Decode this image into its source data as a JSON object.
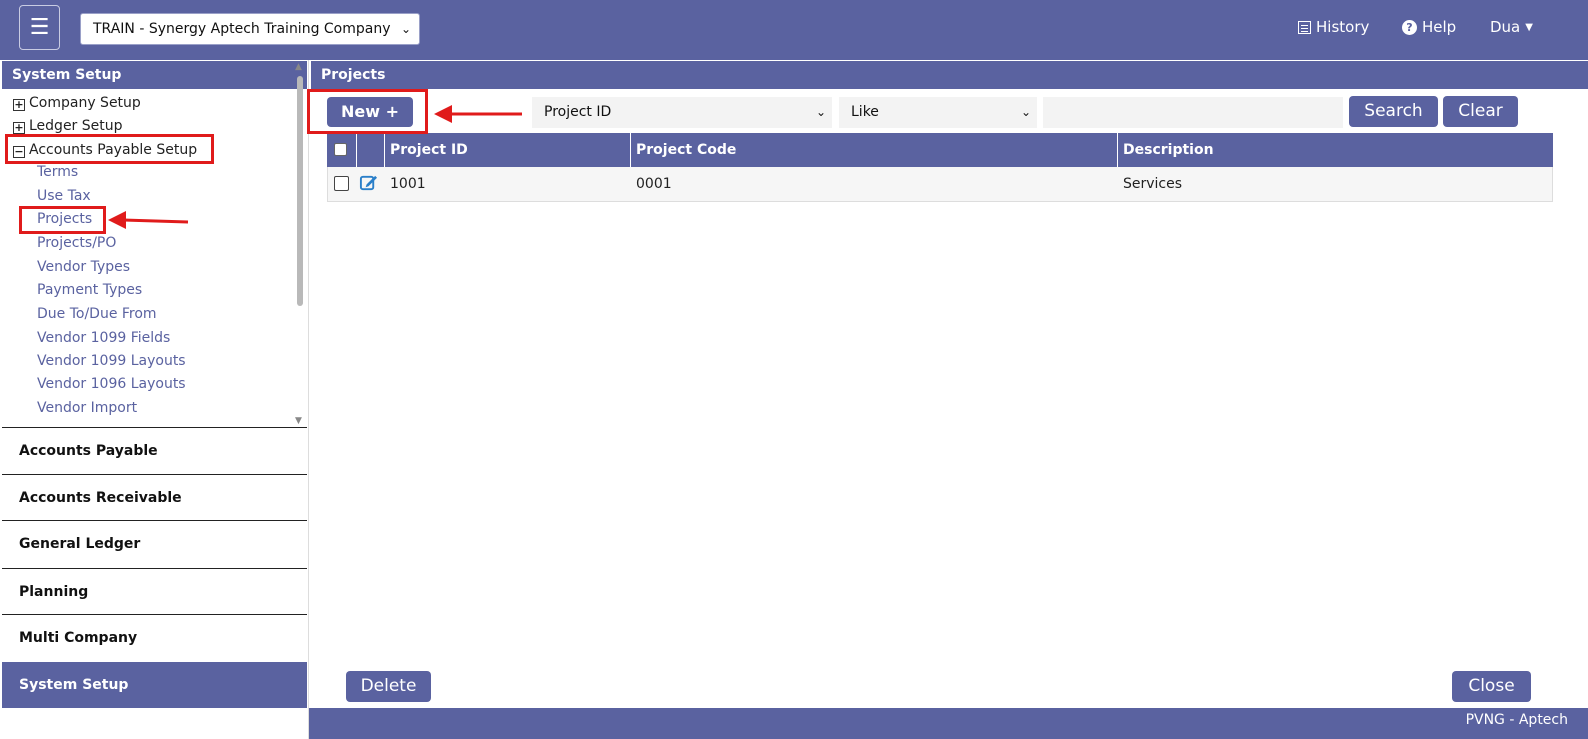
{
  "topbar": {
    "menu_icon": "hamburger-icon",
    "company_select": "TRAIN - Synergy Aptech Training Company",
    "history_label": "History",
    "help_label": "Help",
    "user_label": "Dua"
  },
  "sidebar": {
    "header": "System Setup",
    "tree": {
      "company_setup": "Company Setup",
      "ledger_setup": "Ledger Setup",
      "ap_setup": "Accounts Payable Setup",
      "ap_children": [
        "Terms",
        "Use Tax",
        "Projects",
        "Projects/PO",
        "Vendor Types",
        "Payment Types",
        "Due To/Due From",
        "Vendor 1099 Fields",
        "Vendor 1099 Layouts",
        "Vendor 1096 Layouts",
        "Vendor Import"
      ]
    },
    "modules": [
      "Accounts Payable",
      "Accounts Receivable",
      "General Ledger",
      "Planning",
      "Multi Company",
      "System Setup"
    ]
  },
  "main": {
    "title": "Projects",
    "new_button": "New",
    "filter_field": "Project ID",
    "filter_operator": "Like",
    "search_value": "",
    "search_button": "Search",
    "clear_button": "Clear",
    "columns": [
      "Project ID",
      "Project Code",
      "Description"
    ],
    "rows": [
      {
        "project_id": "1001",
        "project_code": "0001",
        "description": "Services"
      }
    ],
    "delete_button": "Delete",
    "close_button": "Close"
  },
  "footer": {
    "text": "PVNG - Aptech"
  },
  "colors": {
    "brand": "#5a62a0",
    "annotation": "#e01b1b"
  }
}
